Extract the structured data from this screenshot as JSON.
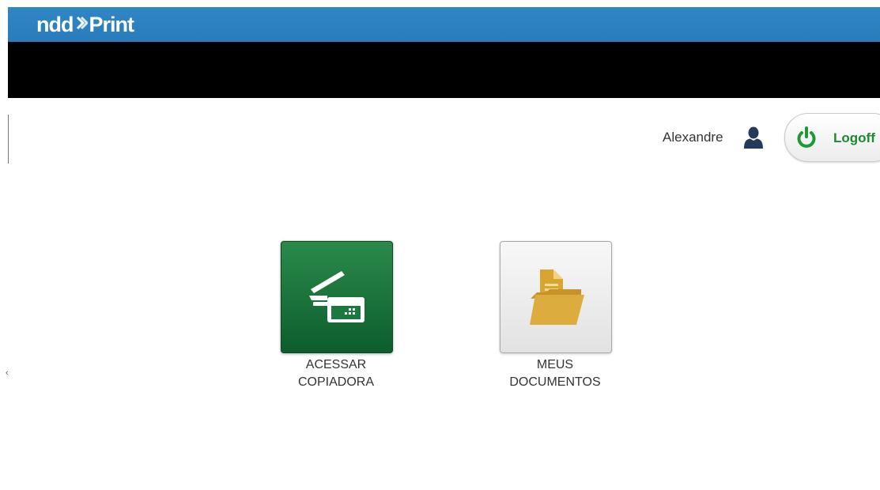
{
  "header": {
    "logo_part1": "ndd",
    "logo_part2": "Print",
    "background_color": "#2a7cba"
  },
  "user": {
    "name": "Alexandre",
    "icon": "user-icon"
  },
  "logoff": {
    "label": "Logoff",
    "icon": "power-icon",
    "color": "#1d8a2f"
  },
  "tiles": [
    {
      "id": "copy",
      "line1": "ACESSAR",
      "line2": "COPIADORA",
      "icon": "copier-icon",
      "color": "#0d5d2d"
    },
    {
      "id": "documents",
      "line1": "MEUS",
      "line2": "DOCUMENTOS",
      "icon": "folder-document-icon",
      "color": "#d4a530"
    }
  ]
}
